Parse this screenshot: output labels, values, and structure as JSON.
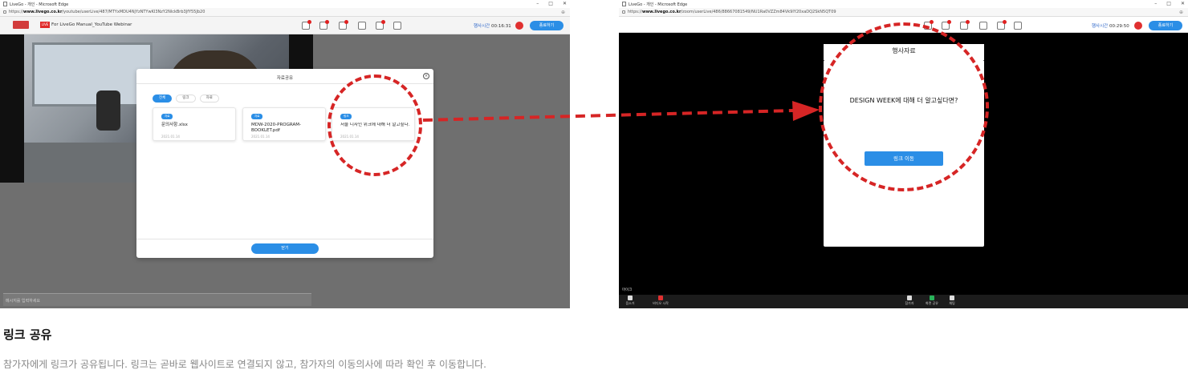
{
  "left_window": {
    "title": "LiveGo - 개인 - Microsoft Edge",
    "url": "https://www.livego.co.kr/youtube/userLive/487/MTYxMDU4NjYzNTYwKI3NzY2NlckBrb3JfY55Jb20",
    "url_prefix": "https://",
    "url_host": "www.livego.co.kr",
    "url_path": "/youtube/userLive/487/MTYxMDU4NjYzNTYwKI3NzY2NlckBrb3JfY55Jb20",
    "brand_badge": "LIVE",
    "session_title": "For LiveGo Manual_YouTube Webinar",
    "timer_label": "행사시간",
    "timer_value": "00:16:31",
    "end_button": "종료하기",
    "chat_placeholder": "메시지를 입력하세요",
    "modal": {
      "title": "자료공유",
      "close_icon": "×",
      "filters": [
        "전체",
        "링크",
        "자료"
      ],
      "cards": [
        {
          "tag": "자료",
          "name": "문의사항.xlsx",
          "date": "2021.01.14"
        },
        {
          "tag": "자료",
          "name": "MDW-2020-PROGRAM-BOOKLET.pdf",
          "date": "2021.01.14"
        },
        {
          "tag": "링크",
          "name": "서울 디자인 위크에 대해 더 알고싶다...",
          "date": "2021.01.14"
        }
      ],
      "close_button": "닫기"
    }
  },
  "right_window": {
    "title": "LiveGo - 개인 - Microsoft Edge",
    "url": "https://www.livego.co.kr/zoom/userLive/486/88667081549/NU1Ra0VZZm84Vk9IY20xaDQ2SkN5QT09",
    "url_prefix": "https://",
    "url_host": "www.livego.co.kr",
    "url_path": "/zoom/userLive/486/88667081549/NU1Ra0VZZm84Vk9IY20xaDQ2SkN5QT09",
    "timer_label": "행사시간",
    "timer_value": "00:29:50",
    "end_button": "종료하기",
    "modal": {
      "title": "행사자료",
      "question": "DESIGN WEEK에 대해 더 알고싶다면?",
      "link_button": "링크 이동"
    },
    "presenter_label": "마이크",
    "controls": [
      {
        "label": "음소거"
      },
      {
        "label": "비디오 시작"
      },
      {
        "label": "참가자"
      },
      {
        "label": "화면 공유"
      },
      {
        "label": "채팅"
      }
    ]
  },
  "caption": {
    "title": "링크 공유",
    "description": "참가자에게 링크가 공유됩니다. 링크는 곧바로 웹사이트로 연결되지 않고, 참가자의 이동의사에 따라 확인 후 이동합니다."
  },
  "colors": {
    "accent": "#2b8ee6",
    "annotation_red": "#d62525",
    "live_red": "#e02a2a"
  }
}
